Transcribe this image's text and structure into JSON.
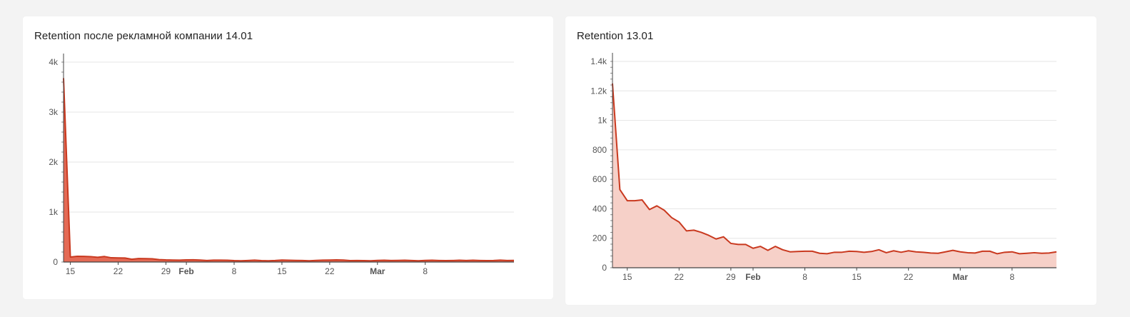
{
  "colors": {
    "line": "#c9391f",
    "area1": "#e46a55",
    "area2": "#f6d0c8",
    "grid": "#e6e6e6",
    "axis": "#555555"
  },
  "chart_data": [
    {
      "type": "area",
      "title": "Retention после рекламной компании 14.01",
      "xlabel": "",
      "ylabel": "",
      "ylim": [
        0,
        4000
      ],
      "yticks": [
        {
          "value": 0,
          "label": "0"
        },
        {
          "value": 1000,
          "label": "1k"
        },
        {
          "value": 2000,
          "label": "2k"
        },
        {
          "value": 3000,
          "label": "3k"
        },
        {
          "value": 4000,
          "label": "4k"
        }
      ],
      "x_start": "2021-01-14",
      "xticks": [
        {
          "date": "2021-01-15",
          "label": "15",
          "bold": false
        },
        {
          "date": "2021-01-22",
          "label": "22",
          "bold": false
        },
        {
          "date": "2021-01-29",
          "label": "29",
          "bold": false
        },
        {
          "date": "2021-02-01",
          "label": "Feb",
          "bold": true
        },
        {
          "date": "2021-02-08",
          "label": "8",
          "bold": false
        },
        {
          "date": "2021-02-15",
          "label": "15",
          "bold": false
        },
        {
          "date": "2021-02-22",
          "label": "22",
          "bold": false
        },
        {
          "date": "2021-03-01",
          "label": "Mar",
          "bold": true
        },
        {
          "date": "2021-03-08",
          "label": "8",
          "bold": false
        }
      ],
      "grid": true,
      "legend": "none",
      "values": [
        3680,
        100,
        115,
        112,
        108,
        95,
        110,
        85,
        82,
        80,
        55,
        70,
        68,
        65,
        48,
        42,
        40,
        38,
        42,
        45,
        40,
        30,
        38,
        38,
        35,
        28,
        25,
        30,
        38,
        28,
        25,
        30,
        40,
        35,
        32,
        30,
        25,
        32,
        38,
        40,
        42,
        40,
        28,
        30,
        28,
        25,
        32,
        35,
        30,
        33,
        35,
        30,
        25,
        32,
        35,
        30,
        28,
        30,
        35,
        30,
        35,
        30,
        28,
        30,
        38,
        30,
        32
      ]
    },
    {
      "type": "area",
      "title": "Retention 13.01",
      "xlabel": "",
      "ylabel": "",
      "ylim": [
        0,
        1400
      ],
      "yticks": [
        {
          "value": 0,
          "label": "0"
        },
        {
          "value": 200,
          "label": "200"
        },
        {
          "value": 400,
          "label": "400"
        },
        {
          "value": 600,
          "label": "600"
        },
        {
          "value": 800,
          "label": "800"
        },
        {
          "value": 1000,
          "label": "1k"
        },
        {
          "value": 1200,
          "label": "1.2k"
        },
        {
          "value": 1400,
          "label": "1.4k"
        }
      ],
      "x_start": "2021-01-13",
      "xticks": [
        {
          "date": "2021-01-15",
          "label": "15",
          "bold": false
        },
        {
          "date": "2021-01-22",
          "label": "22",
          "bold": false
        },
        {
          "date": "2021-01-29",
          "label": "29",
          "bold": false
        },
        {
          "date": "2021-02-01",
          "label": "Feb",
          "bold": true
        },
        {
          "date": "2021-02-08",
          "label": "8",
          "bold": false
        },
        {
          "date": "2021-02-15",
          "label": "15",
          "bold": false
        },
        {
          "date": "2021-02-22",
          "label": "22",
          "bold": false
        },
        {
          "date": "2021-03-01",
          "label": "Mar",
          "bold": true
        },
        {
          "date": "2021-03-08",
          "label": "8",
          "bold": false
        }
      ],
      "grid": true,
      "legend": "none",
      "values": [
        1250,
        530,
        455,
        455,
        460,
        395,
        420,
        390,
        340,
        310,
        250,
        255,
        240,
        220,
        195,
        210,
        165,
        158,
        158,
        132,
        145,
        118,
        145,
        122,
        108,
        110,
        112,
        112,
        98,
        95,
        105,
        105,
        112,
        110,
        105,
        110,
        122,
        102,
        115,
        105,
        115,
        108,
        105,
        100,
        98,
        108,
        118,
        108,
        102,
        100,
        112,
        112,
        95,
        105,
        108,
        95,
        98,
        102,
        98,
        100,
        108
      ]
    }
  ]
}
